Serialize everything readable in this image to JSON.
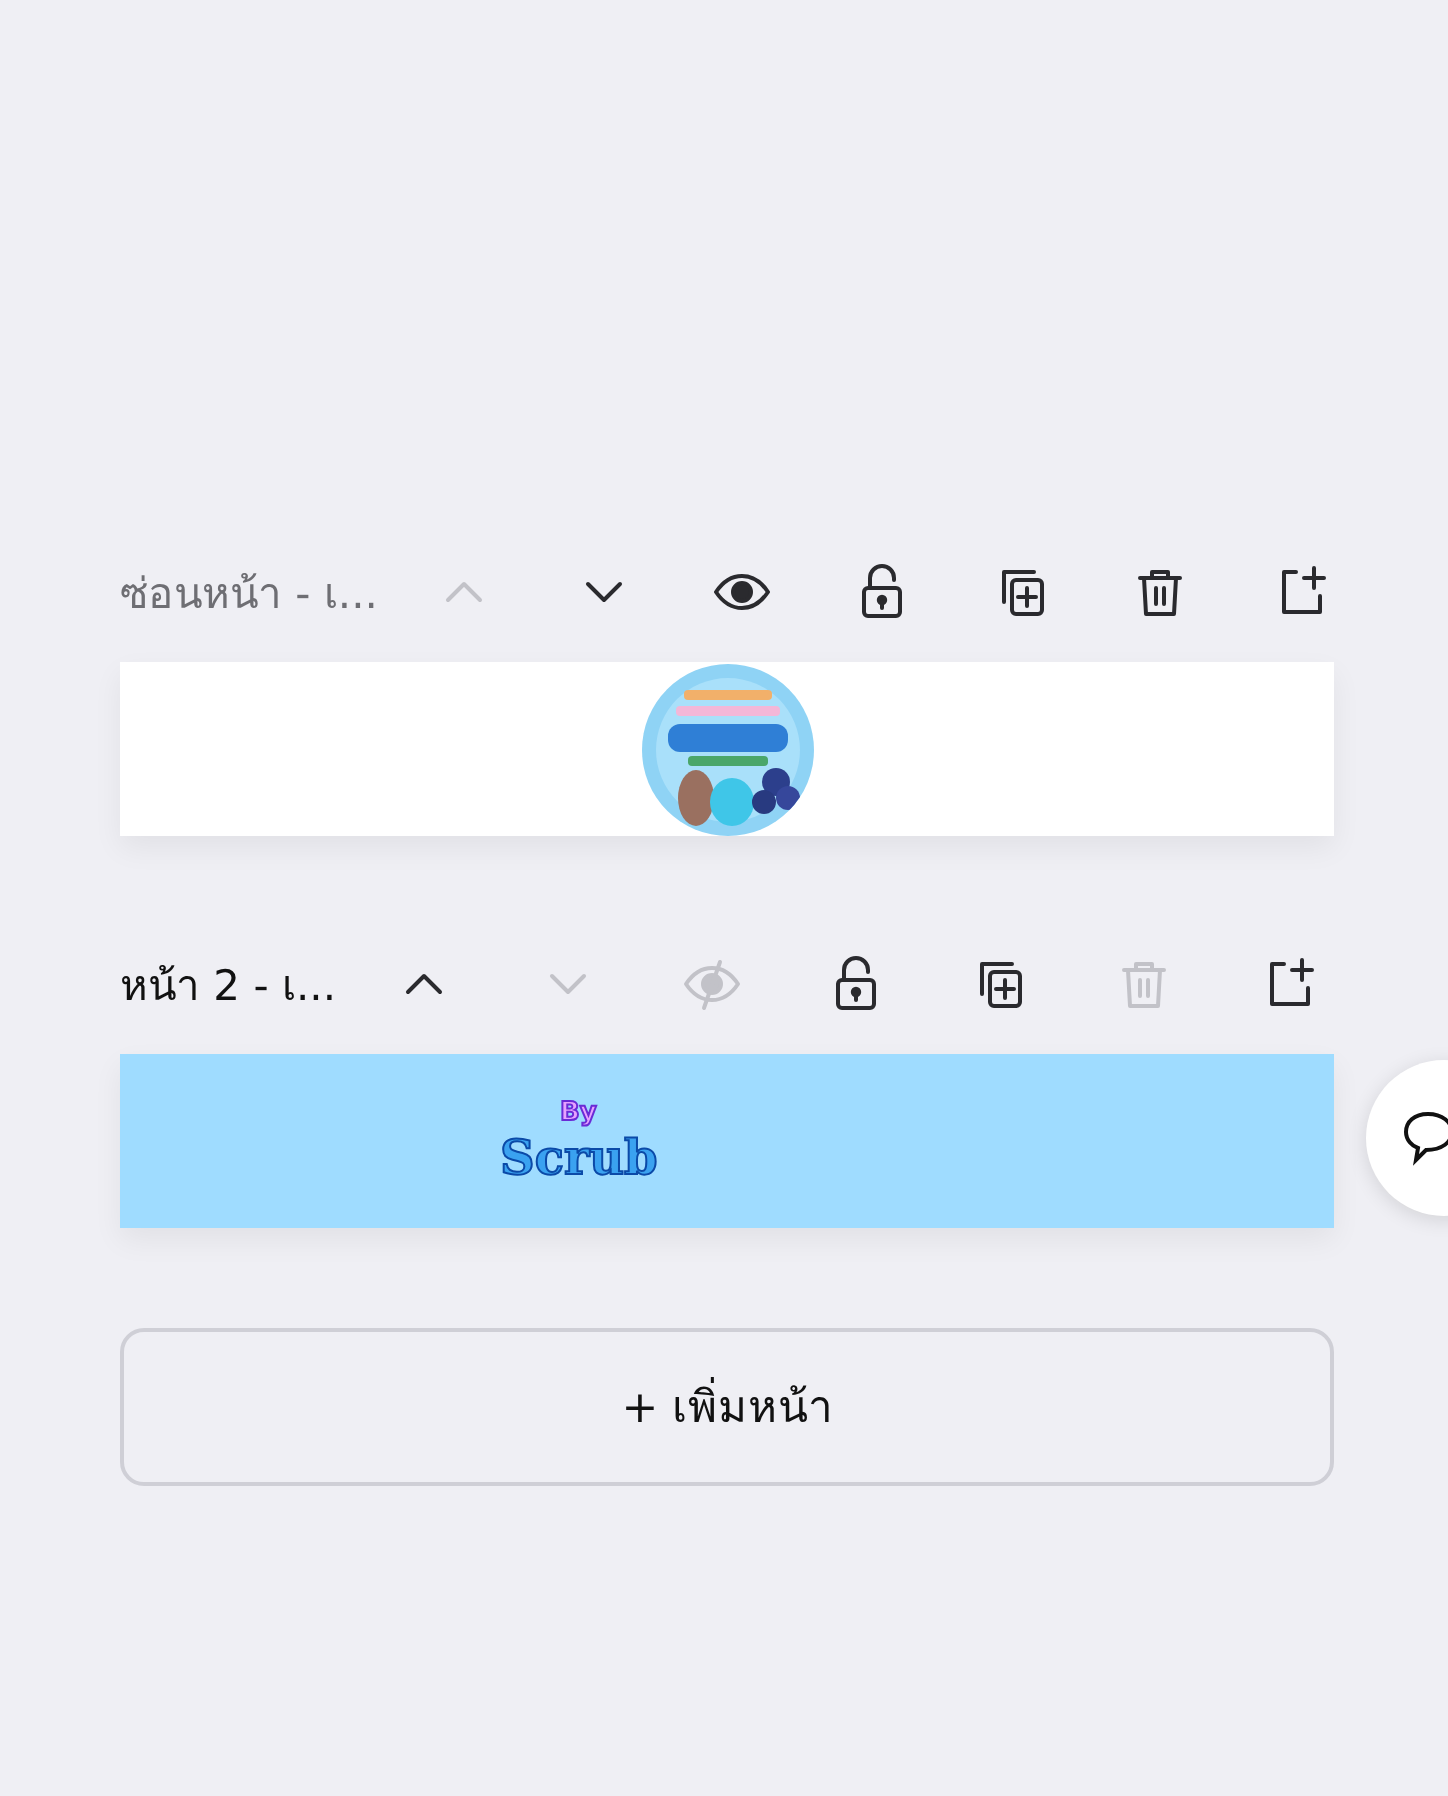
{
  "pages": [
    {
      "title": "ซ่อนหน้า - เ...",
      "hidden": true,
      "tools": [
        {
          "kind": "up",
          "disabled": true
        },
        {
          "kind": "down",
          "disabled": false
        },
        {
          "kind": "eye",
          "disabled": false
        },
        {
          "kind": "lock",
          "disabled": false
        },
        {
          "kind": "duplicate",
          "disabled": false
        },
        {
          "kind": "delete",
          "disabled": false
        },
        {
          "kind": "add",
          "disabled": false
        }
      ]
    },
    {
      "title": "หน้า 2 - เ...",
      "hidden": false,
      "tools": [
        {
          "kind": "up",
          "disabled": false
        },
        {
          "kind": "down",
          "disabled": true
        },
        {
          "kind": "eye-off",
          "disabled": true
        },
        {
          "kind": "lock",
          "disabled": false
        },
        {
          "kind": "duplicate",
          "disabled": false
        },
        {
          "kind": "delete",
          "disabled": true
        },
        {
          "kind": "add",
          "disabled": false
        }
      ],
      "content": {
        "kind": "text",
        "small": "By",
        "large": "Scrub"
      }
    }
  ],
  "add_page_button": "+ เพิ่มหน้า"
}
